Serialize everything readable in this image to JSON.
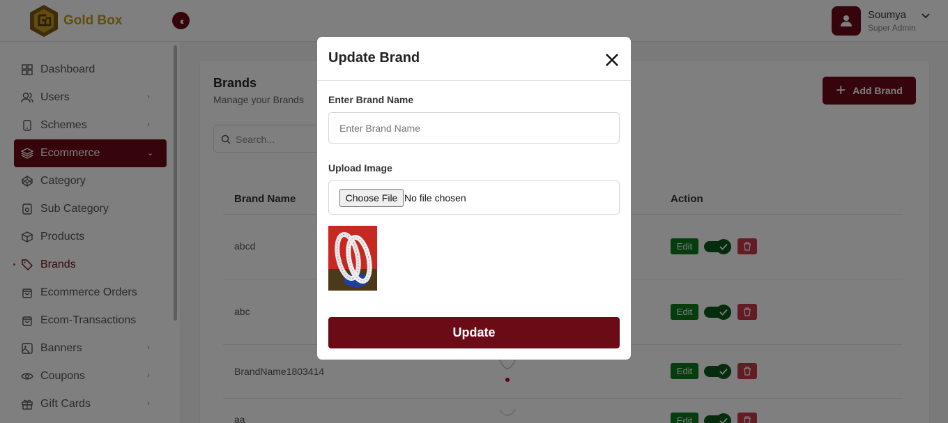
{
  "app": {
    "name": "Gold Box"
  },
  "user": {
    "name": "Soumya",
    "role": "Super Admin"
  },
  "sidebar": {
    "items": [
      {
        "label": "Dashboard",
        "icon": "grid-icon"
      },
      {
        "label": "Users",
        "icon": "users-icon"
      },
      {
        "label": "Schemes",
        "icon": "mobile-icon"
      },
      {
        "label": "Ecommerce",
        "icon": "layers-icon"
      },
      {
        "label": "Category",
        "icon": "codepen-icon"
      },
      {
        "label": "Sub Category",
        "icon": "disc-icon"
      },
      {
        "label": "Products",
        "icon": "box-icon"
      },
      {
        "label": "Brands",
        "icon": "tag-icon"
      },
      {
        "label": "Ecommerce Orders",
        "icon": "shopping-bag-icon"
      },
      {
        "label": "Ecom-Transactions",
        "icon": "shopping-bag-icon"
      },
      {
        "label": "Banners",
        "icon": "image-icon"
      },
      {
        "label": "Coupons",
        "icon": "eye-icon"
      },
      {
        "label": "Gift Cards",
        "icon": "gift-icon"
      }
    ]
  },
  "page": {
    "title": "Brands",
    "subtitle": "Manage your Brands",
    "add_button": "Add Brand",
    "search_placeholder": "Search..."
  },
  "table": {
    "columns": [
      "Brand Name",
      "Action"
    ],
    "rows": [
      {
        "name": "abcd",
        "edit": "Edit",
        "active": true
      },
      {
        "name": "abc",
        "edit": "Edit",
        "active": true
      },
      {
        "name": "BrandName1803414",
        "edit": "Edit",
        "active": true
      },
      {
        "name": "aa",
        "edit": "Edit",
        "active": true
      }
    ]
  },
  "modal": {
    "title": "Update Brand",
    "name_label": "Enter Brand Name",
    "name_placeholder": "Enter Brand Name",
    "name_value": "",
    "image_label": "Upload Image",
    "choose_file": "Choose File",
    "no_file": "No file chosen",
    "submit": "Update"
  },
  "colors": {
    "primary": "#6b0b16",
    "gold": "#c59a1b",
    "success": "#0a7a1f",
    "danger": "#c43b48"
  }
}
